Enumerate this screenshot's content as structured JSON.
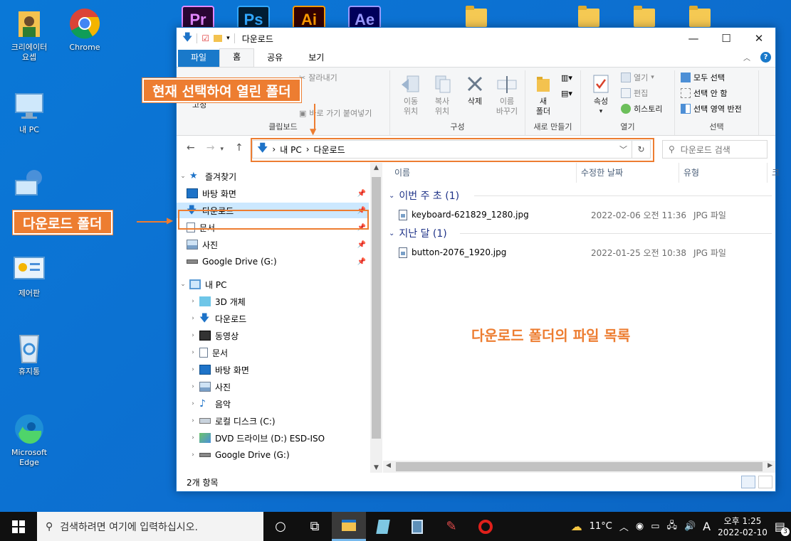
{
  "desktop": {
    "icons": [
      {
        "label": "크리에이터\n요셉"
      },
      {
        "label": "Chrome"
      },
      {
        "label": "내 PC"
      },
      {
        "label": "제어판"
      },
      {
        "label": "휴지통"
      },
      {
        "label": "Microsoft\nEdge"
      }
    ],
    "adobe": [
      "Pr",
      "Ps",
      "Ai",
      "Ae"
    ]
  },
  "window": {
    "title": "다운로드",
    "tabs": [
      "파일",
      "홈",
      "공유",
      "보기"
    ],
    "ribbon": {
      "clipboard": {
        "pin": "고정",
        "cut": "잘라내기",
        "paste_shortcut": "바로 가기 붙여넣기",
        "label": "클립보드"
      },
      "organize": {
        "move": "이동\n위치",
        "copy": "복사\n위치",
        "delete": "삭제",
        "rename": "이름\n바꾸기",
        "label": "구성"
      },
      "new": {
        "new_folder": "새\n폴더",
        "label": "새로 만들기"
      },
      "open": {
        "properties": "속성",
        "open": "열기",
        "edit": "편집",
        "history": "히스토리",
        "label": "열기"
      },
      "select": {
        "all": "모두 선택",
        "none": "선택 안 함",
        "invert": "선택 영역 반전",
        "label": "선택"
      }
    },
    "address": {
      "pc": "내 PC",
      "folder": "다운로드"
    },
    "search_placeholder": "다운로드 검색",
    "nav": {
      "quick_access": "즐겨찾기",
      "quick_items": [
        "바탕 화면",
        "다운로드",
        "문서",
        "사진",
        "Google Drive (G:)"
      ],
      "this_pc": "내 PC",
      "pc_items": [
        "3D 개체",
        "다운로드",
        "동영상",
        "문서",
        "바탕 화면",
        "사진",
        "음악",
        "로컬 디스크 (C:)",
        "DVD 드라이브 (D:) ESD-ISO",
        "Google Drive (G:)"
      ]
    },
    "columns": [
      "이름",
      "수정한 날짜",
      "유형",
      "크"
    ],
    "groups": [
      {
        "label": "이번 주 초 (1)",
        "files": [
          {
            "name": "keyboard-621829_1280.jpg",
            "date": "2022-02-06 오전 11:36",
            "type": "JPG 파일"
          }
        ]
      },
      {
        "label": "지난 달 (1)",
        "files": [
          {
            "name": "button-2076_1920.jpg",
            "date": "2022-01-25 오전 10:38",
            "type": "JPG 파일"
          }
        ]
      }
    ],
    "status": "2개 항목"
  },
  "annotations": {
    "current_folder": "현재 선택하여 열린 폴더",
    "downloads_folder": "다운로드 폴더",
    "file_list": "다운로드 폴더의 파일 목록"
  },
  "taskbar": {
    "search": "검색하려면 여기에 입력하십시오.",
    "weather": "11°C",
    "ime": "A",
    "time": "오후 1:25",
    "date": "2022-02-10",
    "notif_count": "3"
  },
  "colors": {
    "accent": "#ed7d31",
    "selection": "#cce8ff",
    "file_tab": "#1979ca",
    "desktop": "#0a78d7"
  }
}
